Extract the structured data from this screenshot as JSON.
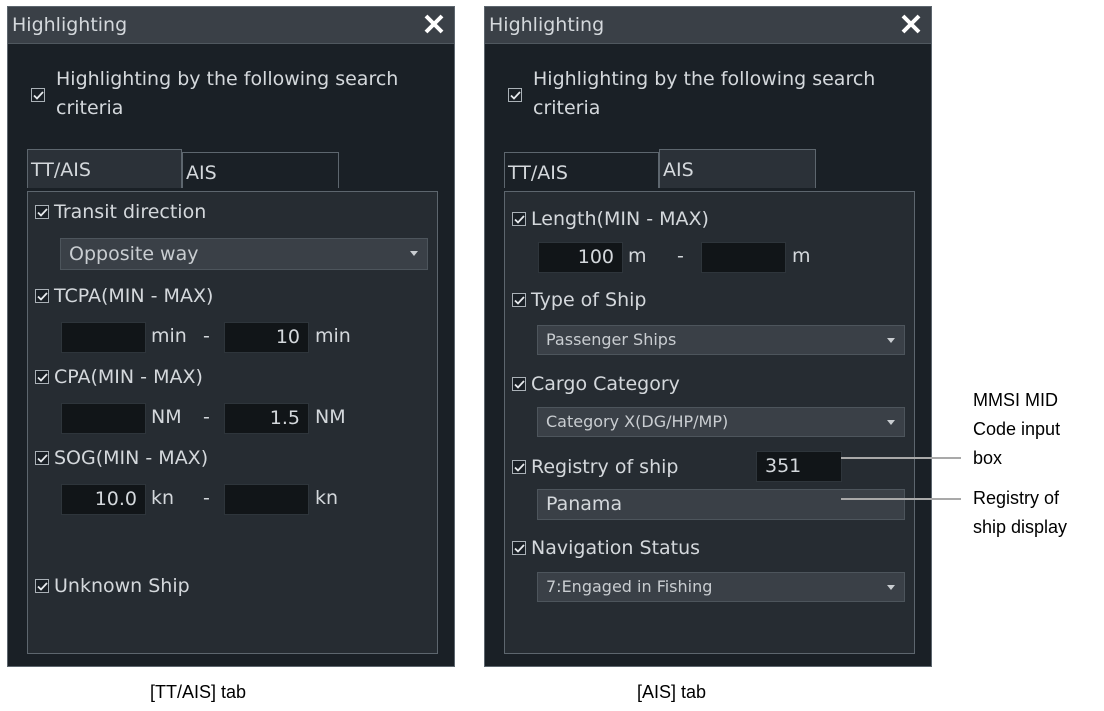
{
  "left_panel": {
    "title": "Highlighting",
    "highlight_label": "Highlighting by the following search criteria",
    "tabs": [
      "TT/AIS",
      "AIS"
    ],
    "transit_direction": {
      "label": "Transit direction",
      "value": "Opposite way"
    },
    "tcpa": {
      "label": "TCPA(MIN - MAX)",
      "min": "",
      "min_unit": "min",
      "dash": "-",
      "max": "10",
      "max_unit": "min"
    },
    "cpa": {
      "label": "CPA(MIN - MAX)",
      "min": "",
      "min_unit": "NM",
      "dash": "-",
      "max": "1.5",
      "max_unit": "NM"
    },
    "sog": {
      "label": "SOG(MIN - MAX)",
      "min": "10.0",
      "min_unit": "kn",
      "dash": "-",
      "max": "",
      "max_unit": "kn"
    },
    "unknown_ship": {
      "label": "Unknown Ship"
    },
    "caption": "[TT/AIS] tab"
  },
  "right_panel": {
    "title": "Highlighting",
    "highlight_label": "Highlighting by the following search criteria",
    "tabs": [
      "TT/AIS",
      "AIS"
    ],
    "length": {
      "label": "Length(MIN - MAX)",
      "min": "100",
      "min_unit": "m",
      "dash": "-",
      "max": "",
      "max_unit": "m"
    },
    "type_of_ship": {
      "label": "Type of Ship",
      "value": "Passenger Ships"
    },
    "cargo_category": {
      "label": "Cargo Category",
      "value": "Category X(DG/HP/MP)"
    },
    "registry": {
      "label": "Registry of ship",
      "mid_code": "351",
      "display": "Panama"
    },
    "navigation_status": {
      "label": "Navigation Status",
      "value": "7:Engaged in Fishing"
    },
    "caption": "[AIS] tab"
  },
  "callouts": {
    "mmsi": [
      "MMSI MID",
      "Code input",
      "box"
    ],
    "registry": [
      "Registry of",
      "ship display"
    ]
  },
  "colors": {
    "panel_bg": "#1a2026",
    "content_bg": "#262c32",
    "text": "#d4d8dc",
    "input_bg": "#111518"
  }
}
